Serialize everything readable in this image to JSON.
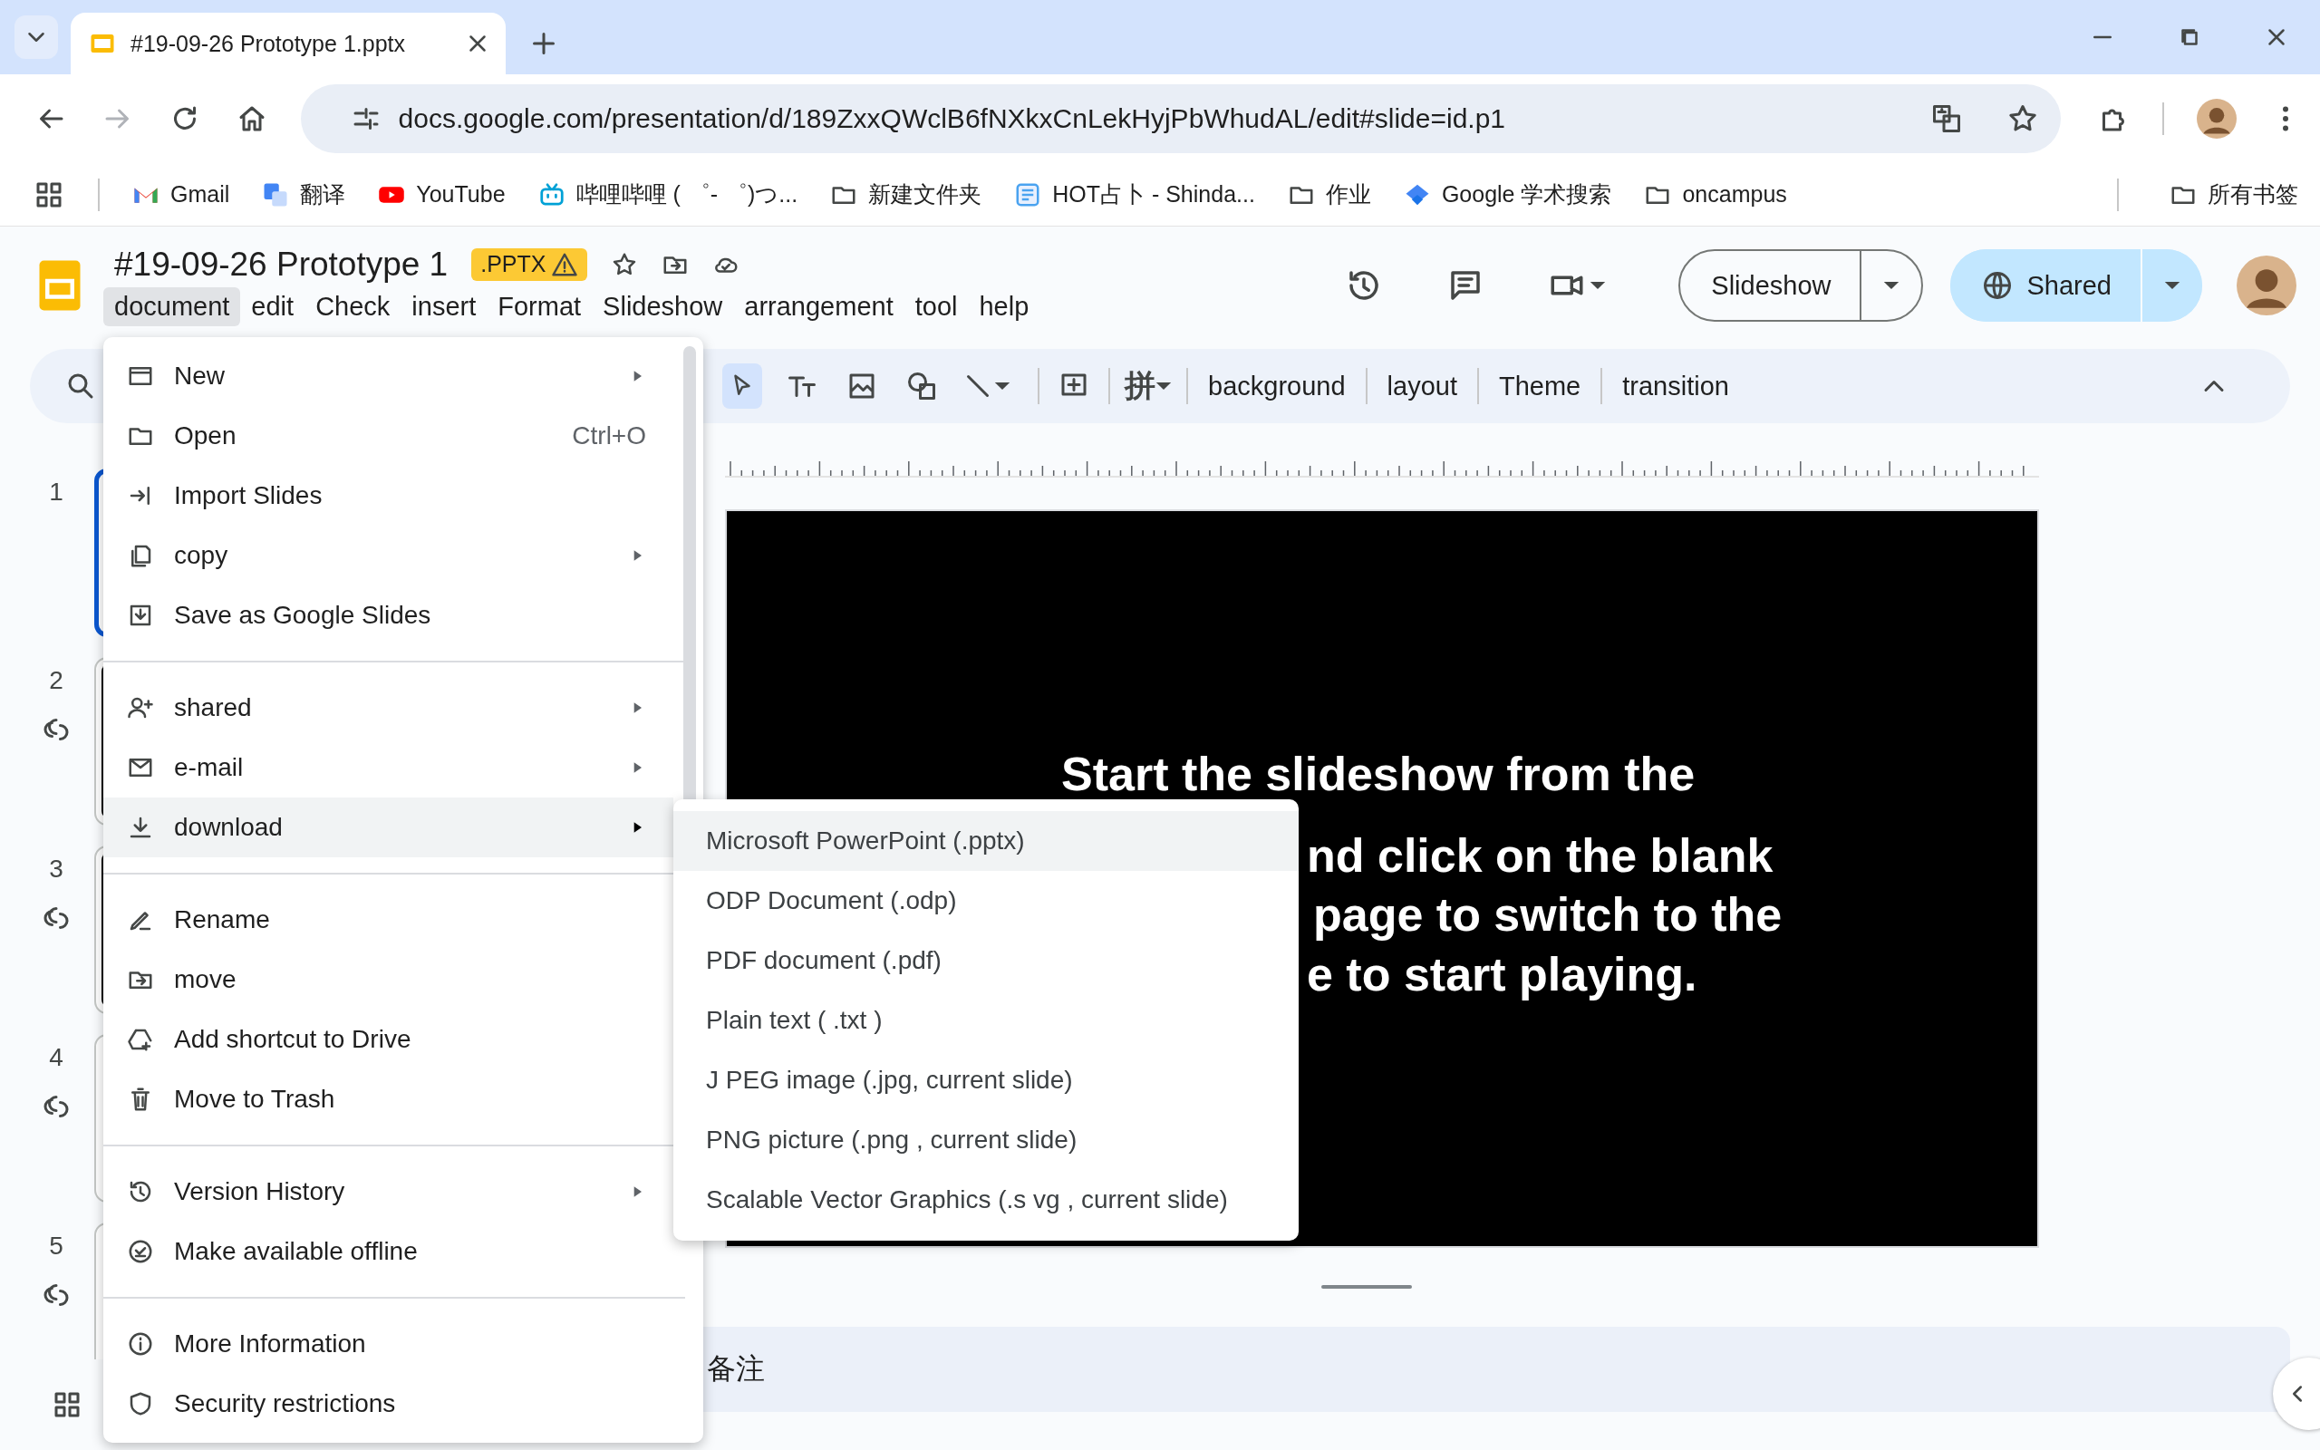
{
  "browser": {
    "tabs": [
      {
        "title": "#19-09-26 Prototype 1.pptx",
        "selected": true
      }
    ],
    "nav": [
      {
        "kind": "back",
        "disabled": false
      },
      {
        "kind": "forward",
        "disabled": true
      },
      {
        "kind": "reload",
        "disabled": false
      },
      {
        "kind": "home",
        "disabled": false
      }
    ],
    "address": {
      "url": "docs.google.com/presentation/d/189ZxxQWclB6fNXkxCnLekHyjPbWhudAL/edit#slide=id.p1"
    },
    "bookmarks": [
      {
        "kind": "gmail",
        "label": "Gmail"
      },
      {
        "kind": "translate",
        "label": "翻译"
      },
      {
        "kind": "youtube",
        "label": "YouTube"
      },
      {
        "kind": "bilibili",
        "label": "哔哩哔哩 ( ゜- ゜)つ..."
      },
      {
        "kind": "folder",
        "label": "新建文件夹"
      },
      {
        "kind": "hot",
        "label": "HOT占卜 - Shinda..."
      },
      {
        "kind": "folder",
        "label": "作业"
      },
      {
        "kind": "scholar",
        "label": "Google 学术搜索"
      },
      {
        "kind": "folder",
        "label": "oncampus"
      }
    ],
    "all_bookmarks": "所有书签"
  },
  "document": {
    "title": "#19-09-26 Prototype 1",
    "format_badge": ".PPTX",
    "menus": [
      {
        "label": "document",
        "selected": true
      },
      {
        "label": "edit",
        "selected": false
      },
      {
        "label": "Check",
        "selected": false
      },
      {
        "label": "insert",
        "selected": false
      },
      {
        "label": "Format",
        "selected": false
      },
      {
        "label": "Slideshow",
        "selected": false
      },
      {
        "label": "arrangement",
        "selected": false
      },
      {
        "label": "tool",
        "selected": false
      },
      {
        "label": "help",
        "selected": false
      }
    ],
    "slideshow_button": "Slideshow",
    "share_button": "Shared"
  },
  "toolbar": {
    "input_tools": "拼",
    "buttons": [
      "background",
      "layout",
      "Theme",
      "transition"
    ]
  },
  "slides": [
    {
      "number": "1",
      "selected": true,
      "linked": false,
      "dark": true
    },
    {
      "number": "2",
      "selected": false,
      "linked": true,
      "dark": true
    },
    {
      "number": "3",
      "selected": false,
      "linked": true,
      "dark": true
    },
    {
      "number": "4",
      "selected": false,
      "linked": true,
      "dark": false
    },
    {
      "number": "5",
      "selected": false,
      "linked": true,
      "dark": false
    }
  ],
  "slide": {
    "text_lines": [
      "Start the slideshow from the",
      "nd click on the blank",
      "page to switch to the",
      "e to start playing."
    ]
  },
  "notes": {
    "text": "备注"
  },
  "file_menu": {
    "groups": [
      [
        {
          "label": "New",
          "has_submenu": true,
          "selected": false
        },
        {
          "label": "Open",
          "shortcut": "Ctrl+O",
          "has_submenu": false,
          "selected": false
        },
        {
          "label": "Import Slides",
          "has_submenu": false,
          "selected": false
        },
        {
          "label": "copy",
          "has_submenu": true,
          "selected": false
        },
        {
          "label": "Save as Google Slides",
          "has_submenu": false,
          "selected": false
        }
      ],
      [
        {
          "label": "shared",
          "has_submenu": true,
          "selected": false
        },
        {
          "label": "e-mail",
          "has_submenu": true,
          "selected": false
        },
        {
          "label": "download",
          "has_submenu": true,
          "selected": true
        }
      ],
      [
        {
          "label": "Rename",
          "has_submenu": false,
          "selected": false
        },
        {
          "label": "move",
          "has_submenu": false,
          "selected": false
        },
        {
          "label": "Add shortcut to Drive",
          "has_submenu": false,
          "selected": false
        },
        {
          "label": "Move to Trash",
          "has_submenu": false,
          "selected": false
        }
      ],
      [
        {
          "label": "Version History",
          "has_submenu": true,
          "selected": false
        },
        {
          "label": "Make available offline",
          "has_submenu": false,
          "selected": false
        }
      ],
      [
        {
          "label": "More Information",
          "has_submenu": false,
          "selected": false
        },
        {
          "label": "Security restrictions",
          "has_submenu": false,
          "selected": false
        }
      ]
    ]
  },
  "download_submenu": {
    "items": [
      {
        "label": "Microsoft PowerPoint (.pptx)",
        "selected": true
      },
      {
        "label": "ODP Document (.odp)",
        "selected": false
      },
      {
        "label": "PDF document (.pdf)",
        "selected": false
      },
      {
        "label": "Plain text ( .txt )",
        "selected": false
      },
      {
        "label": "J PEG image (.jpg, current slide)",
        "selected": false
      },
      {
        "label": "PNG picture (.png , current slide)",
        "selected": false
      },
      {
        "label": "Scalable Vector Graphics (.s vg , current slide)",
        "selected": false
      }
    ]
  }
}
